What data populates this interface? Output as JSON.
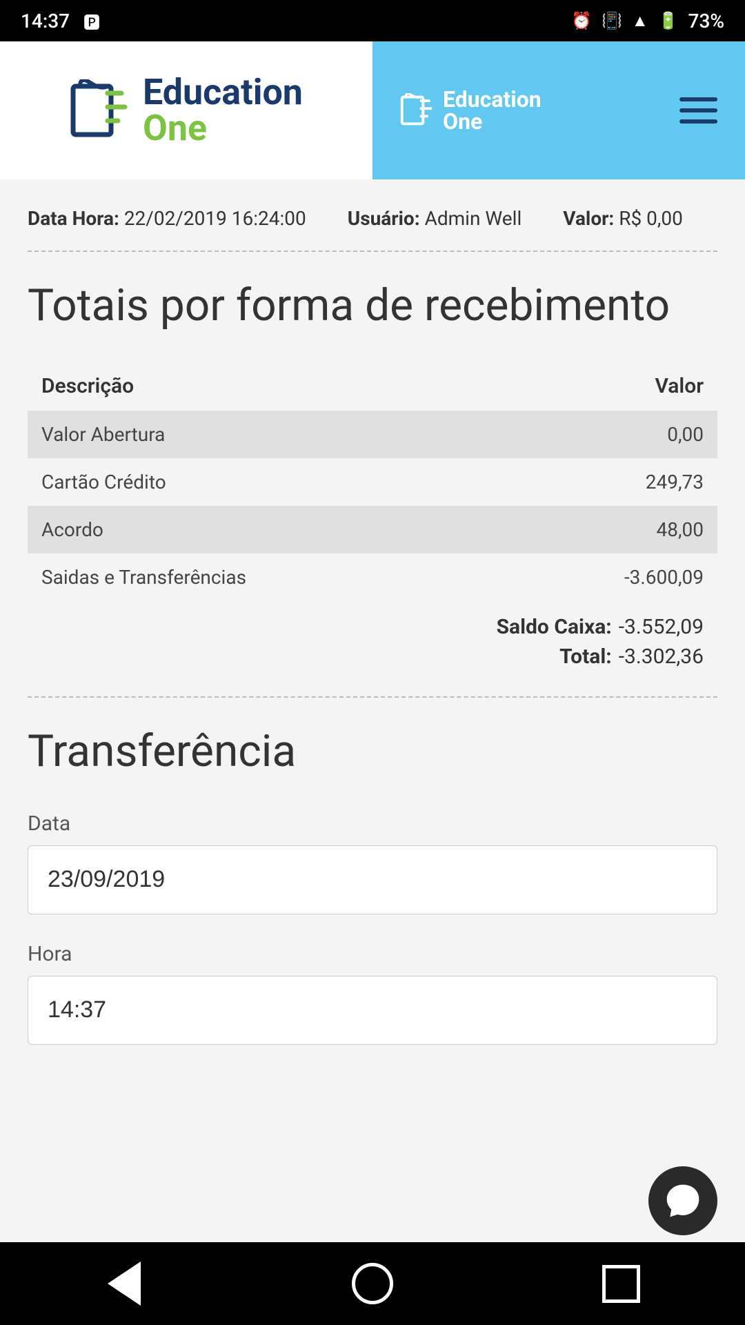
{
  "statusBar": {
    "time": "14:37",
    "battery": "73%"
  },
  "header": {
    "logoTextEducation": "Education",
    "logoTextOne": "One",
    "navLogoEducation": "Education",
    "navLogoOne": "One"
  },
  "metaInfo": {
    "dataHoraLabel": "Data Hora:",
    "dataHoraValue": "22/02/2019 16:24:00",
    "usuarioLabel": "Usuário:",
    "usuarioValue": "Admin Well",
    "valorLabel": "Valor:",
    "valorValue": "R$ 0,00"
  },
  "sectionTitle": "Totais por forma de recebimento",
  "table": {
    "headerDescricao": "Descrição",
    "headerValor": "Valor",
    "rows": [
      {
        "descricao": "Valor Abertura",
        "valor": "0,00",
        "shaded": true
      },
      {
        "descricao": "Cartão Crédito",
        "valor": "249,73",
        "shaded": false
      },
      {
        "descricao": "Acordo",
        "valor": "48,00",
        "shaded": true
      },
      {
        "descricao": "Saidas e Transferências",
        "valor": "-3.600,09",
        "shaded": false
      }
    ]
  },
  "summary": {
    "saldoCaixaLabel": "Saldo Caixa:",
    "saldoCaixaValue": "-3.552,09",
    "totalLabel": "Total:",
    "totalValue": "-3.302,36"
  },
  "transferenciaSection": {
    "title": "Transferência",
    "dataLabel": "Data",
    "dataValue": "23/09/2019",
    "horaLabel": "Hora",
    "horaValue": "14:37"
  }
}
